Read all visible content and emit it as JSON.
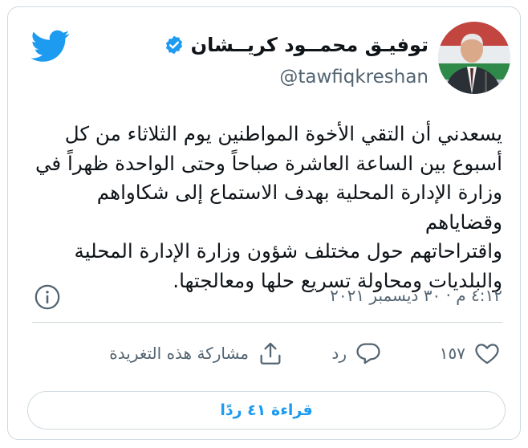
{
  "user": {
    "display_name": "توفيـق محمــود كريــشان",
    "handle": "@tawfiqkreshan"
  },
  "tweet": {
    "lines": [
      "يسعدني أن التقي الأخوة المواطنين يوم الثلاثاء من كل",
      "أسبوع بين الساعة العاشرة صباحاً وحتى الواحدة ظهراً في",
      "وزارة الإدارة المحلية بهدف الاستماع إلى شكاواهم وقضاياهم",
      "واقتراحاتهم حول مختلف شؤون وزارة الإدارة المحلية",
      "والبلديات ومحاولة تسريع حلها ومعالجتها."
    ],
    "timestamp": "٤:١٢ م · ٣٠ ديسمبر ٢٠٢١"
  },
  "actions": {
    "like_count": "١٥٧",
    "reply_label": "رد",
    "share_label": "مشاركة هذه التغريدة"
  },
  "read_replies_button": "قراءة ٤١ ردًا",
  "colors": {
    "brand_blue": "#1d9bf0",
    "text": "#0f1419",
    "secondary": "#536471",
    "border": "#cfd9de"
  }
}
